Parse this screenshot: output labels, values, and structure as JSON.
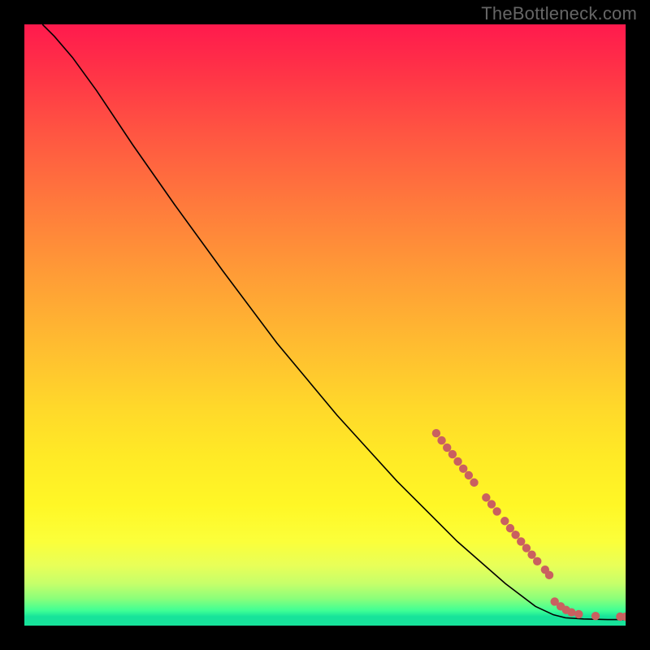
{
  "watermark": "TheBottleneck.com",
  "colors": {
    "page_bg": "#000000",
    "watermark_text": "#666666",
    "curve_stroke": "#000000",
    "point_fill": "#c96060",
    "gradient_top": "#ff1a4d",
    "gradient_bottom": "#17e39a"
  },
  "chart_data": {
    "type": "line",
    "title": "",
    "xlabel": "",
    "ylabel": "",
    "xlim": [
      0,
      100
    ],
    "ylim": [
      0,
      100
    ],
    "grid": false,
    "legend": false,
    "annotations": [],
    "curve": [
      {
        "x": 3,
        "y": 100
      },
      {
        "x": 5,
        "y": 98
      },
      {
        "x": 8,
        "y": 94.5
      },
      {
        "x": 12,
        "y": 89
      },
      {
        "x": 18,
        "y": 80
      },
      {
        "x": 25,
        "y": 70
      },
      {
        "x": 33,
        "y": 59
      },
      {
        "x": 42,
        "y": 47
      },
      {
        "x": 52,
        "y": 35
      },
      {
        "x": 62,
        "y": 24
      },
      {
        "x": 72,
        "y": 14
      },
      {
        "x": 80,
        "y": 7
      },
      {
        "x": 85,
        "y": 3.2
      },
      {
        "x": 88,
        "y": 1.8
      },
      {
        "x": 90,
        "y": 1.3
      },
      {
        "x": 93,
        "y": 1.1
      },
      {
        "x": 97,
        "y": 1.0
      },
      {
        "x": 100,
        "y": 1.0
      }
    ],
    "series": [
      {
        "name": "points",
        "points": [
          {
            "x": 68.5,
            "y": 32.0
          },
          {
            "x": 69.4,
            "y": 30.8
          },
          {
            "x": 70.3,
            "y": 29.6
          },
          {
            "x": 71.2,
            "y": 28.5
          },
          {
            "x": 72.1,
            "y": 27.3
          },
          {
            "x": 73.0,
            "y": 26.1
          },
          {
            "x": 73.9,
            "y": 25.0
          },
          {
            "x": 74.8,
            "y": 23.8
          },
          {
            "x": 76.8,
            "y": 21.3
          },
          {
            "x": 77.7,
            "y": 20.2
          },
          {
            "x": 78.6,
            "y": 19.0
          },
          {
            "x": 79.9,
            "y": 17.4
          },
          {
            "x": 80.8,
            "y": 16.2
          },
          {
            "x": 81.7,
            "y": 15.1
          },
          {
            "x": 82.6,
            "y": 14.0
          },
          {
            "x": 83.5,
            "y": 12.9
          },
          {
            "x": 84.4,
            "y": 11.8
          },
          {
            "x": 85.3,
            "y": 10.7
          },
          {
            "x": 86.6,
            "y": 9.3
          },
          {
            "x": 87.3,
            "y": 8.4
          },
          {
            "x": 88.2,
            "y": 4.0
          },
          {
            "x": 89.2,
            "y": 3.2
          },
          {
            "x": 90.1,
            "y": 2.6
          },
          {
            "x": 91.0,
            "y": 2.2
          },
          {
            "x": 92.2,
            "y": 1.9
          },
          {
            "x": 95.0,
            "y": 1.6
          },
          {
            "x": 99.1,
            "y": 1.5
          },
          {
            "x": 100.0,
            "y": 1.5
          }
        ]
      }
    ]
  }
}
